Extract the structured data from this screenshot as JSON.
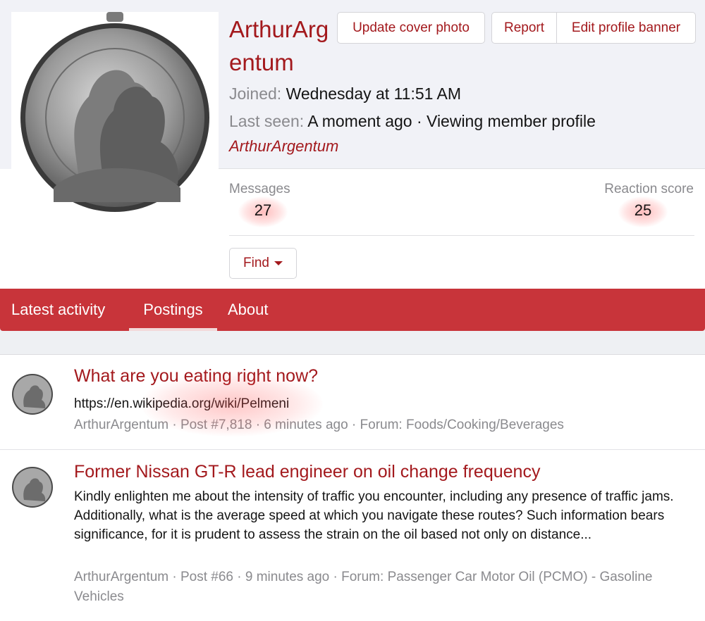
{
  "profile": {
    "username": "ArthurArgentum",
    "joined_label": "Joined:",
    "joined_value": "Wednesday at 11:51 AM",
    "lastseen_label": "Last seen:",
    "lastseen_value": "A moment ago · Viewing member profile",
    "lastseen_user": "ArthurArgentum",
    "avatar_icon": "medal-portrait-avatar"
  },
  "buttons": {
    "update_cover": "Update cover photo",
    "report": "Report",
    "edit_banner": "Edit profile banner",
    "find": "Find"
  },
  "stats": {
    "messages_label": "Messages",
    "messages_value": "27",
    "reaction_label": "Reaction score",
    "reaction_value": "25"
  },
  "tabs": [
    {
      "label": "Latest activity",
      "active": false
    },
    {
      "label": "Postings",
      "active": true
    },
    {
      "label": "About",
      "active": false
    }
  ],
  "results": [
    {
      "title": "What are you eating right now?",
      "snippet": "https://en.wikipedia.org/wiki/Pelmeni",
      "meta": "ArthurArgentum · Post #7,818 · 6 minutes ago · Forum: Foods/Cooking/Beverages"
    },
    {
      "title": "Former Nissan GT-R lead engineer on oil change frequency",
      "snippet": "Kindly enlighten me about the intensity of traffic you encounter, including any presence of traffic jams. Additionally, what is the average speed at which you navigate these routes? Such information bears significance, for it is prudent to assess the strain on the oil based not only on distance...",
      "meta": "ArthurArgentum · Post #66 · 9 minutes ago · Forum: Passenger Car Motor Oil (PCMO) - Gasoline Vehicles"
    }
  ],
  "colors": {
    "accent": "#a3191d",
    "tab_bar": "#c8343a",
    "muted": "#8a8a8e"
  }
}
